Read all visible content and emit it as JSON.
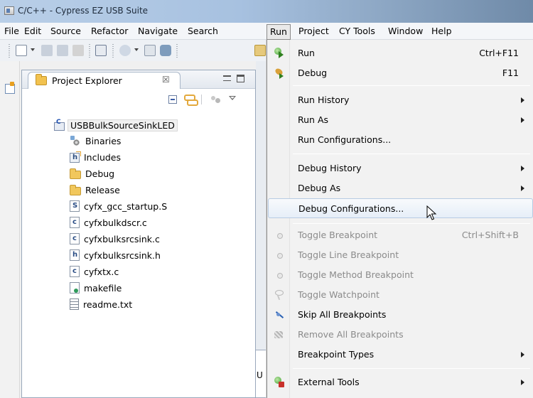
{
  "window": {
    "title": "C/C++ - Cypress EZ USB Suite"
  },
  "menubar": [
    {
      "id": "file",
      "label": "File"
    },
    {
      "id": "edit",
      "label": "Edit"
    },
    {
      "id": "source",
      "label": "Source"
    },
    {
      "id": "refactor",
      "label": "Refactor"
    },
    {
      "id": "navigate",
      "label": "Navigate"
    },
    {
      "id": "search",
      "label": "Search"
    },
    {
      "id": "run",
      "label": "Run"
    },
    {
      "id": "project",
      "label": "Project"
    },
    {
      "id": "cytools",
      "label": "CY Tools"
    },
    {
      "id": "window",
      "label": "Window"
    },
    {
      "id": "help",
      "label": "Help"
    }
  ],
  "explorer": {
    "title": "Project Explorer",
    "close_glyph": "☒",
    "tree": [
      {
        "label": "USBBulkSourceSinkLED",
        "icon": "project-icon",
        "level": 0,
        "selected": true
      },
      {
        "label": "Binaries",
        "icon": "binaries-icon",
        "level": 1
      },
      {
        "label": "Includes",
        "icon": "includes-icon",
        "level": 1
      },
      {
        "label": "Debug",
        "icon": "folder-icon",
        "level": 1
      },
      {
        "label": "Release",
        "icon": "folder-icon",
        "level": 1
      },
      {
        "label": "cyfx_gcc_startup.S",
        "icon": "asm-file-icon",
        "level": 1
      },
      {
        "label": "cyfxbulkdscr.c",
        "icon": "c-file-icon",
        "level": 1
      },
      {
        "label": "cyfxbulksrcsink.c",
        "icon": "c-file-icon",
        "level": 1
      },
      {
        "label": "cyfxbulksrcsink.h",
        "icon": "h-file-icon",
        "level": 1
      },
      {
        "label": "cyfxtx.c",
        "icon": "c-file-icon",
        "level": 1
      },
      {
        "label": "makefile",
        "icon": "makefile-icon",
        "level": 1
      },
      {
        "label": "readme.txt",
        "icon": "text-file-icon",
        "level": 1
      }
    ]
  },
  "run_menu": {
    "items": [
      {
        "label": "Run",
        "shortcut": "Ctrl+F11",
        "icon": "run-icon",
        "enabled": true
      },
      {
        "label": "Debug",
        "shortcut": "F11",
        "icon": "debug-icon",
        "enabled": true
      },
      {
        "separator": true
      },
      {
        "label": "Run History",
        "submenu": true,
        "enabled": true
      },
      {
        "label": "Run As",
        "submenu": true,
        "enabled": true
      },
      {
        "label": "Run Configurations...",
        "enabled": true
      },
      {
        "separator": true
      },
      {
        "label": "Debug History",
        "submenu": true,
        "enabled": true
      },
      {
        "label": "Debug As",
        "submenu": true,
        "enabled": true
      },
      {
        "label": "Debug Configurations...",
        "enabled": true,
        "hover": true
      },
      {
        "separator": true
      },
      {
        "label": "Toggle Breakpoint",
        "shortcut": "Ctrl+Shift+B",
        "icon": "breakpoint-icon",
        "enabled": false
      },
      {
        "label": "Toggle Line Breakpoint",
        "icon": "line-breakpoint-icon",
        "enabled": false
      },
      {
        "label": "Toggle Method Breakpoint",
        "icon": "method-breakpoint-icon",
        "enabled": false
      },
      {
        "label": "Toggle Watchpoint",
        "icon": "watchpoint-icon",
        "enabled": false
      },
      {
        "label": "Skip All Breakpoints",
        "icon": "skip-breakpoints-icon",
        "enabled": true
      },
      {
        "label": "Remove All Breakpoints",
        "icon": "remove-breakpoints-icon",
        "enabled": false
      },
      {
        "label": "Breakpoint Types",
        "submenu": true,
        "enabled": true
      },
      {
        "separator": true
      },
      {
        "label": "External Tools",
        "submenu": true,
        "icon": "external-tools-icon",
        "enabled": true
      }
    ]
  },
  "background_editor": {
    "tab_letter": "U"
  },
  "colors": {
    "menu_hover_border": "#b7cbe3",
    "disabled_text": "#8b8b8b",
    "title_gradient_start": "#b9cfe8"
  }
}
